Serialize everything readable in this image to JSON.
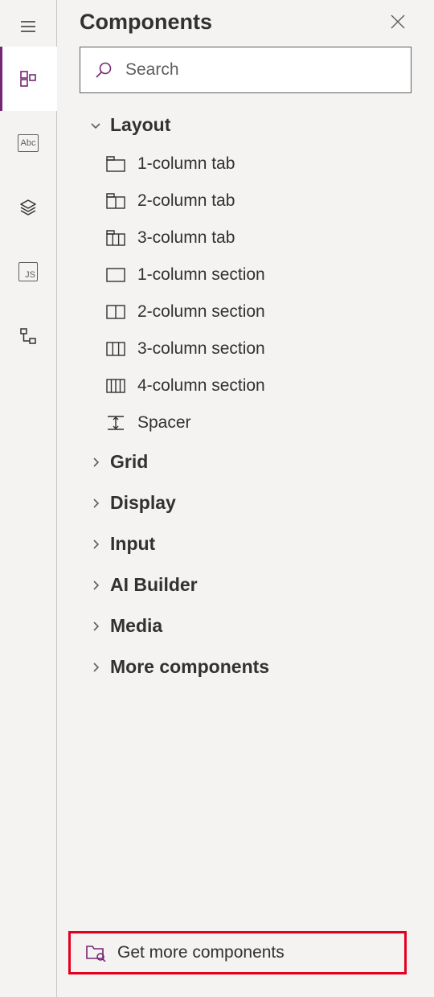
{
  "panel": {
    "title": "Components"
  },
  "search": {
    "placeholder": "Search",
    "value": ""
  },
  "categories": [
    {
      "key": "layout",
      "label": "Layout",
      "expanded": true,
      "items": [
        {
          "key": "1-column-tab",
          "label": "1-column tab",
          "icon": "one-col-tab"
        },
        {
          "key": "2-column-tab",
          "label": "2-column tab",
          "icon": "two-col-tab"
        },
        {
          "key": "3-column-tab",
          "label": "3-column tab",
          "icon": "three-col-tab"
        },
        {
          "key": "1-column-section",
          "label": "1-column section",
          "icon": "one-col-section"
        },
        {
          "key": "2-column-section",
          "label": "2-column section",
          "icon": "two-col-section"
        },
        {
          "key": "3-column-section",
          "label": "3-column section",
          "icon": "three-col-section"
        },
        {
          "key": "4-column-section",
          "label": "4-column section",
          "icon": "four-col-section"
        },
        {
          "key": "spacer",
          "label": "Spacer",
          "icon": "spacer"
        }
      ]
    },
    {
      "key": "grid",
      "label": "Grid",
      "expanded": false
    },
    {
      "key": "display",
      "label": "Display",
      "expanded": false
    },
    {
      "key": "input",
      "label": "Input",
      "expanded": false
    },
    {
      "key": "ai-builder",
      "label": "AI Builder",
      "expanded": false
    },
    {
      "key": "media",
      "label": "Media",
      "expanded": false
    },
    {
      "key": "more-components",
      "label": "More components",
      "expanded": false
    }
  ],
  "footer": {
    "label": "Get more components"
  },
  "rail": {
    "abc": "Abc",
    "js": "JS"
  },
  "colors": {
    "accent": "#742774",
    "highlight": "#e3001f",
    "text": "#323130",
    "border": "#605e5c",
    "bg": "#f4f3f2"
  }
}
